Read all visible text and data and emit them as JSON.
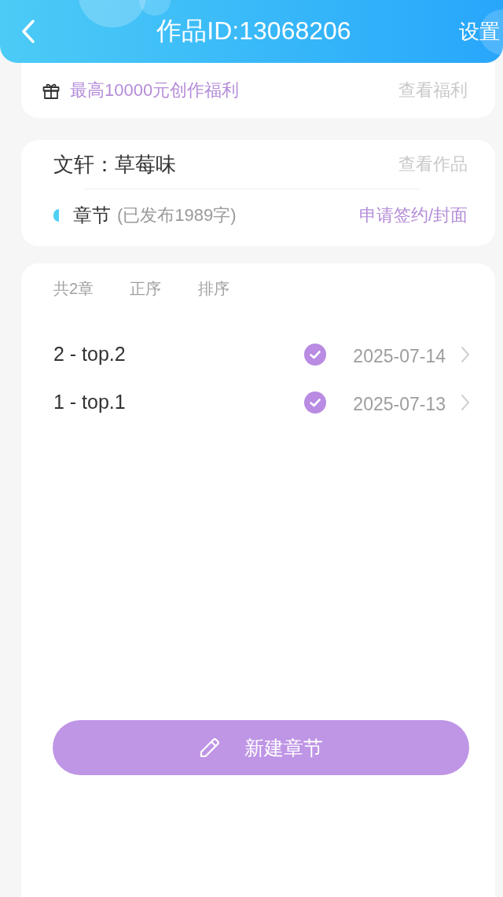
{
  "header": {
    "title": "作品ID:13068206",
    "action": "设置"
  },
  "welfare": {
    "text": "最高10000元创作福利",
    "link": "查看福利"
  },
  "work": {
    "name": "文轩：草莓味",
    "link": "查看作品",
    "section": {
      "label": "章节",
      "note": "(已发布1989字)",
      "link": "申请签约/封面"
    }
  },
  "chapters": {
    "count": "共2章",
    "sort_options": [
      {
        "label": "正序"
      },
      {
        "label": "排序"
      }
    ],
    "items": [
      {
        "title": "2 - top.2",
        "published": true,
        "date": "2025-07-14"
      },
      {
        "title": "1 - top.1",
        "published": true,
        "date": "2025-07-13"
      }
    ]
  },
  "new_button": {
    "label": "新建章节"
  }
}
